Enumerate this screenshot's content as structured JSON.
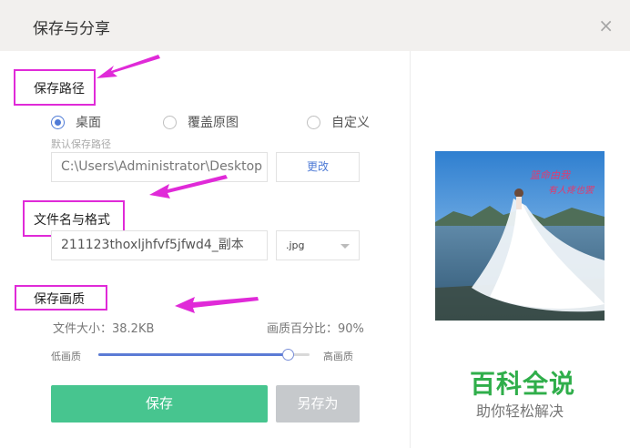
{
  "dialog": {
    "title": "保存与分享",
    "close_glyph": "×"
  },
  "save_path": {
    "label": "保存路径",
    "options": [
      {
        "label": "桌面",
        "checked": true
      },
      {
        "label": "覆盖原图",
        "checked": false
      },
      {
        "label": "自定义",
        "checked": false
      }
    ],
    "hint": "默认保存路径",
    "path_value": "C:\\Users\\Administrator\\Desktop",
    "change_button": "更改"
  },
  "file": {
    "label": "文件名与格式",
    "name_value": "211123thoxljhfvf5jfwd4_副本",
    "format_value": ".jpg"
  },
  "quality": {
    "label": "保存画质",
    "file_size": "文件大小：38.2KB",
    "percent_text": "画质百分比：90%",
    "low_label": "低画质",
    "high_label": "高画质",
    "level": 0.9
  },
  "actions": {
    "save": "保存",
    "save_as": "另存为"
  },
  "preview": {
    "overlay_line1": "篮命由我",
    "overlay_line2": "有人疼也罢"
  },
  "watermark": {
    "brand": "百科全说",
    "slogan": "助你轻松解决"
  },
  "colors": {
    "accent_blue": "#4f7bd6",
    "save_green": "#47c58f",
    "annotation_magenta": "#e02ad8",
    "brand_green": "#2fae4a"
  },
  "icons": [
    "close-icon",
    "radio-icon",
    "chevron-down-icon",
    "annotation-arrow-icon"
  ]
}
